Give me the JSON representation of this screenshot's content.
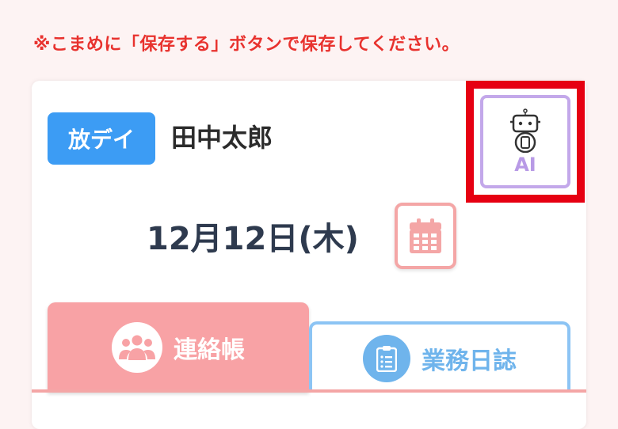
{
  "notice": "※こまめに「保存する」ボタンで保存してください。",
  "badge": "放デイ",
  "child_name": "田中太郎",
  "ai_button": {
    "label": "AI"
  },
  "date": "12月12日(木)",
  "tabs": [
    {
      "label": "連絡帳",
      "icon": "group-icon"
    },
    {
      "label": "業務日誌",
      "icon": "clipboard-list-icon"
    }
  ],
  "colors": {
    "notice": "#e8322e",
    "badge": "#3c9cf4",
    "ai_border": "#c3a8ea",
    "highlight": "#e60012",
    "calendar": "#f4a6a6",
    "tab_active": "#f8a2a5",
    "tab_inactive": "#6fb4ec"
  }
}
